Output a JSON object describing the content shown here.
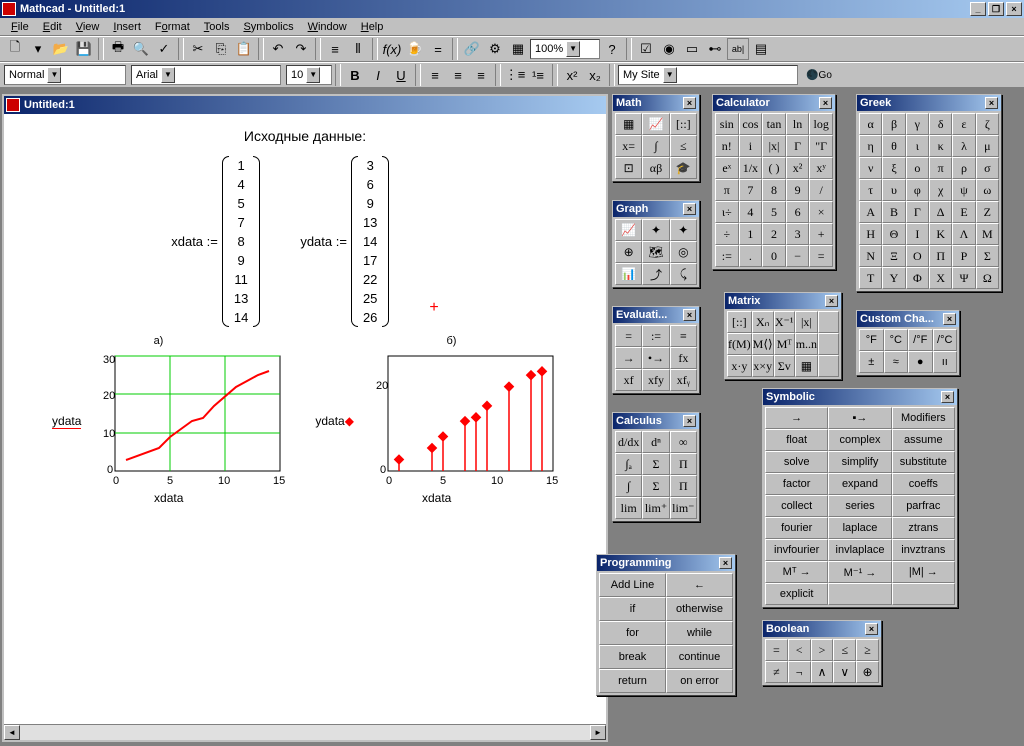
{
  "app": {
    "title": "Mathcad - Untitled:1",
    "doc_title": "Untitled:1"
  },
  "menus": [
    "File",
    "Edit",
    "View",
    "Insert",
    "Format",
    "Tools",
    "Symbolics",
    "Window",
    "Help"
  ],
  "format_bar": {
    "style": "Normal",
    "font": "Arial",
    "size": "10",
    "zoom": "100%",
    "site": "My Site",
    "go": "Go"
  },
  "doc": {
    "heading": "Исходные данные:",
    "xlabel": "xdata :=",
    "ylabel": "ydata :=",
    "xdata": [
      "1",
      "4",
      "5",
      "7",
      "8",
      "9",
      "11",
      "13",
      "14"
    ],
    "ydata": [
      "3",
      "6",
      "9",
      "13",
      "14",
      "17",
      "22",
      "25",
      "26"
    ],
    "caption_a": "а)",
    "caption_b": "б)",
    "axis_y_label": "ydata",
    "axis_x_label": "xdata"
  },
  "chart_data": [
    {
      "type": "line",
      "title": "а)",
      "xlabel": "xdata",
      "ylabel": "ydata",
      "xlim": [
        0,
        15
      ],
      "ylim": [
        0,
        30
      ],
      "xticks": [
        0,
        5,
        10,
        15
      ],
      "yticks": [
        0,
        10,
        20,
        30
      ],
      "x": [
        1,
        4,
        5,
        7,
        8,
        9,
        11,
        13,
        14
      ],
      "y": [
        3,
        6,
        9,
        13,
        14,
        17,
        22,
        25,
        26
      ],
      "grid": true,
      "color": "#ff0000"
    },
    {
      "type": "stem",
      "title": "б)",
      "xlabel": "xdata",
      "ylabel": "ydata",
      "xlim": [
        0,
        15
      ],
      "ylim": [
        0,
        20
      ],
      "xticks_approx": [
        0,
        5,
        10,
        15
      ],
      "yticks_approx": [
        0,
        20
      ],
      "x": [
        1,
        4,
        5,
        7,
        8,
        9,
        11,
        13,
        14
      ],
      "y": [
        3,
        6,
        9,
        13,
        14,
        17,
        22,
        25,
        26
      ],
      "marker": "diamond",
      "color": "#ff0000"
    }
  ],
  "palettes": {
    "math": {
      "title": "Math"
    },
    "graph": {
      "title": "Graph"
    },
    "evaluation": {
      "title": "Evaluati..."
    },
    "calculus": {
      "title": "Calculus"
    },
    "programming": {
      "title": "Programming",
      "items": [
        "Add Line",
        "←",
        "if",
        "otherwise",
        "for",
        "while",
        "break",
        "continue",
        "return",
        "on error"
      ]
    },
    "calculator": {
      "title": "Calculator",
      "rows": [
        [
          "sin",
          "cos",
          "tan",
          "ln",
          "log"
        ],
        [
          "n!",
          "i",
          "|x|",
          "Γ",
          "\"Γ"
        ],
        [
          "eˣ",
          "1/x",
          "( )",
          "x²",
          "xʸ"
        ],
        [
          "π",
          "7",
          "8",
          "9",
          "/"
        ],
        [
          "ι÷",
          "4",
          "5",
          "6",
          "×"
        ],
        [
          "÷",
          "1",
          "2",
          "3",
          "+"
        ],
        [
          ":=",
          ".",
          "0",
          "−",
          "="
        ]
      ]
    },
    "matrix": {
      "title": "Matrix"
    },
    "symbolic": {
      "title": "Symbolic",
      "rows": [
        [
          "→",
          "▪→",
          "Modifiers"
        ],
        [
          "float",
          "complex",
          "assume"
        ],
        [
          "solve",
          "simplify",
          "substitute"
        ],
        [
          "factor",
          "expand",
          "coeffs"
        ],
        [
          "collect",
          "series",
          "parfrac"
        ],
        [
          "fourier",
          "laplace",
          "ztrans"
        ],
        [
          "invfourier",
          "invlaplace",
          "invztrans"
        ],
        [
          "Mᵀ →",
          "M⁻¹ →",
          "|M| →"
        ],
        [
          "explicit",
          "",
          ""
        ]
      ]
    },
    "boolean": {
      "title": "Boolean",
      "rows": [
        [
          "=",
          "<",
          ">",
          "≤",
          "≥"
        ],
        [
          "≠",
          "¬",
          "∧",
          "∨",
          "⊕"
        ]
      ]
    },
    "greek": {
      "title": "Greek",
      "rows": [
        [
          "α",
          "β",
          "γ",
          "δ",
          "ε",
          "ζ"
        ],
        [
          "η",
          "θ",
          "ι",
          "κ",
          "λ",
          "μ"
        ],
        [
          "ν",
          "ξ",
          "ο",
          "π",
          "ρ",
          "σ"
        ],
        [
          "τ",
          "υ",
          "φ",
          "χ",
          "ψ",
          "ω"
        ],
        [
          "Α",
          "Β",
          "Γ",
          "Δ",
          "Ε",
          "Ζ"
        ],
        [
          "Η",
          "Θ",
          "Ι",
          "Κ",
          "Λ",
          "Μ"
        ],
        [
          "Ν",
          "Ξ",
          "Ο",
          "Π",
          "Ρ",
          "Σ"
        ],
        [
          "Τ",
          "Υ",
          "Φ",
          "Χ",
          "Ψ",
          "Ω"
        ]
      ]
    },
    "custom": {
      "title": "Custom Cha...",
      "rows": [
        [
          "°F",
          "°C",
          "/°F",
          "/°C"
        ],
        [
          "±",
          "≈",
          "●",
          "ıı"
        ]
      ]
    }
  }
}
